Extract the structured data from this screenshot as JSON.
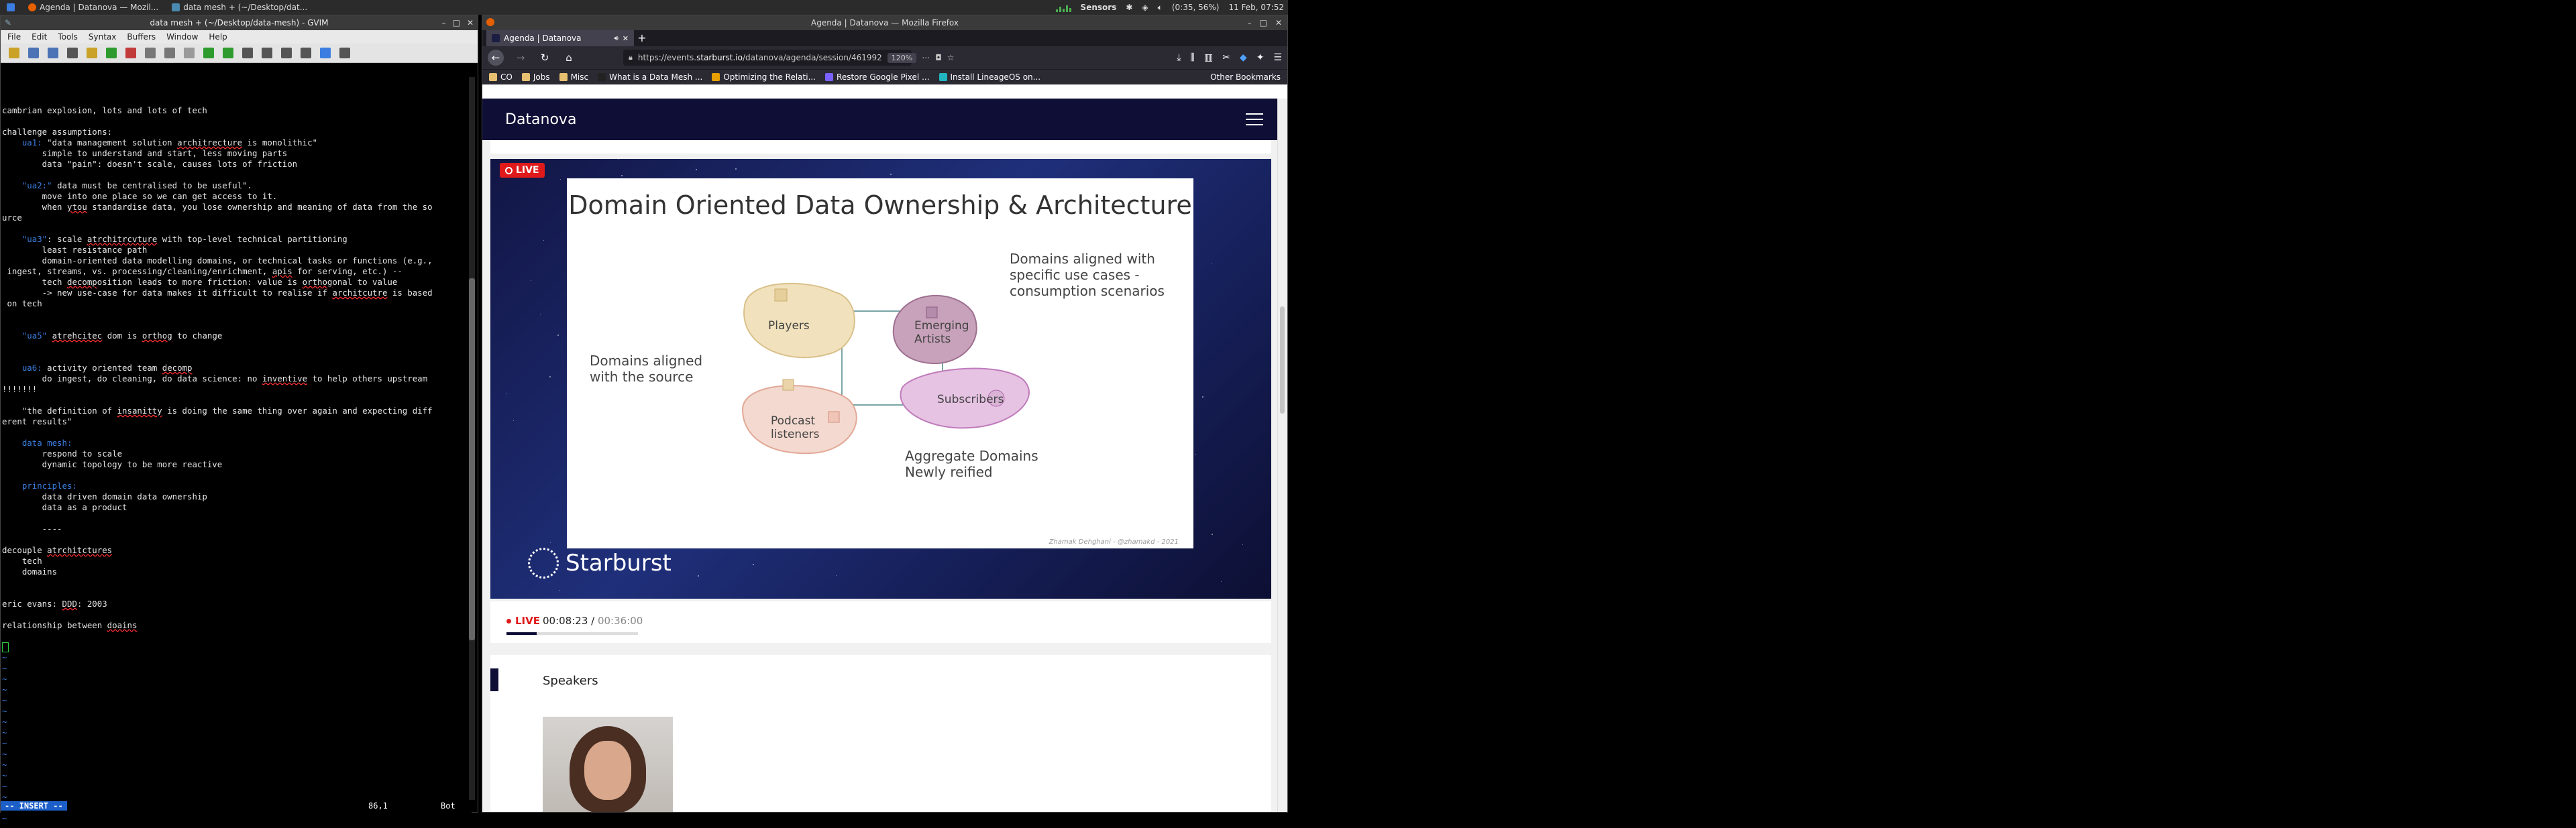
{
  "system_panel": {
    "tasks": [
      {
        "label": "Agenda | Datanova — Mozil...",
        "color": "#e66000"
      },
      {
        "label": "data mesh + (~/Desktop/dat...",
        "color": "#4a8ab0"
      }
    ],
    "sensors_label": "Sensors",
    "battery": "(0:35, 56%)",
    "clock": "11 Feb, 07:52"
  },
  "gvim": {
    "title": "data mesh + (~/Desktop/data-mesh) - GVIM",
    "menu": [
      "File",
      "Edit",
      "Tools",
      "Syntax",
      "Buffers",
      "Window",
      "Help"
    ],
    "toolbar_icons": [
      "open-icon",
      "save-icon",
      "save-all-icon",
      "print-icon",
      "undo-icon",
      "redo-icon",
      "cut-icon",
      "copy-icon",
      "paste-icon",
      "find-icon",
      "find-next-icon",
      "find-prev-icon",
      "load-session-icon",
      "save-session-icon",
      "run-script-icon",
      "make-icon",
      "tags-icon",
      "help-icon"
    ],
    "status": {
      "mode": "-- INSERT --",
      "position": "86,1",
      "scroll": "Bot"
    },
    "lines": [
      "cambrian explosion, lots and lots of tech",
      "",
      "challenge assumptions:",
      "    ua1: \"data management solution architrecture is monolithic\"",
      "        simple to understand and start, less moving parts",
      "        data \"pain\": doesn't scale, causes lots of friction",
      "",
      "    \"ua2:\" data must be centralised to be useful\".",
      "        move into one place so we can get access to it.",
      "        when ytou standardise data, you lose ownership and meaning of data from the so",
      "urce",
      "",
      "    \"ua3\": scale atrchitrcvture with top-level technical partitioning",
      "        least resistance path",
      "        domain-oriented data modelling domains, or technical tasks or functions (e.g.,",
      " ingest, streams, vs. processing/cleaning/enrichment, apis for serving, etc.) --",
      "        tech decomposition leads to more friction: value is orthogonal to value",
      "        -> new use-case for data makes it difficult to realise if architcutre is based",
      " on tech",
      "",
      "",
      "    \"ua5\" atrehcitec dom is orthog to change",
      "",
      "",
      "    ua6: activity oriented team decomp",
      "        do ingest, do cleaning, do data science: no inventive to help others upstream",
      "!!!!!!!",
      "",
      "    \"the definition of insanitty is doing the same thing over again and expecting diff",
      "erent results\"",
      "",
      "    data mesh:",
      "        respond to scale",
      "        dynamic topology to be more reactive",
      "",
      "    principles:",
      "        data driven domain data ownership",
      "        data as a product",
      "",
      "        ----",
      "",
      "decouple atrchitctures",
      "    tech",
      "    domains",
      "",
      "",
      "eric evans: DDD: 2003",
      "",
      "relationship between doains",
      "",
      ""
    ],
    "tilde_count": 20
  },
  "firefox": {
    "window_title": "Agenda | Datanova — Mozilla Firefox",
    "tab_label": "Agenda | Datanova",
    "new_tab": "+",
    "url_prefix": "https://events.",
    "url_host": "starburst.io",
    "url_path": "/datanova/agenda/session/461992",
    "zoom": "120%",
    "bookmarks": [
      {
        "label": "CO",
        "color": "#e8c170"
      },
      {
        "label": "Jobs",
        "color": "#e8c170"
      },
      {
        "label": "Misc",
        "color": "#e8c170"
      },
      {
        "label": "What is a Data Mesh ...",
        "color": "#222"
      },
      {
        "label": "Optimizing the Relati...",
        "color": "#e8a000"
      },
      {
        "label": "Restore Google Pixel ...",
        "color": "#7b61ff"
      },
      {
        "label": "Install LineageOS on...",
        "color": "#21b5c0"
      }
    ],
    "other_bookmarks": "Other Bookmarks"
  },
  "page": {
    "brand": "Datanova",
    "live_badge": "LIVE",
    "slide": {
      "title": "Domain Oriented Data Ownership & Architecture",
      "left_label_1": "Domains aligned",
      "left_label_2": "with the source",
      "right_label_1": "Domains aligned with",
      "right_label_2": "specific use cases  -",
      "right_label_3": "consumption scenarios",
      "bottom_label_1": "Aggregate Domains",
      "bottom_label_2": "Newly reified",
      "blobs": [
        "Players",
        "Podcast listeners",
        "Emerging Artists",
        "Subscribers"
      ],
      "credit": "Zhamak Dehghani - @zhamakd - 2021"
    },
    "video_logo": "Starburst",
    "player": {
      "live": "LIVE",
      "elapsed": "00:08:23",
      "separator": " / ",
      "duration": "00:36:00",
      "progress": 0.23
    },
    "speakers_title": "Speakers"
  }
}
